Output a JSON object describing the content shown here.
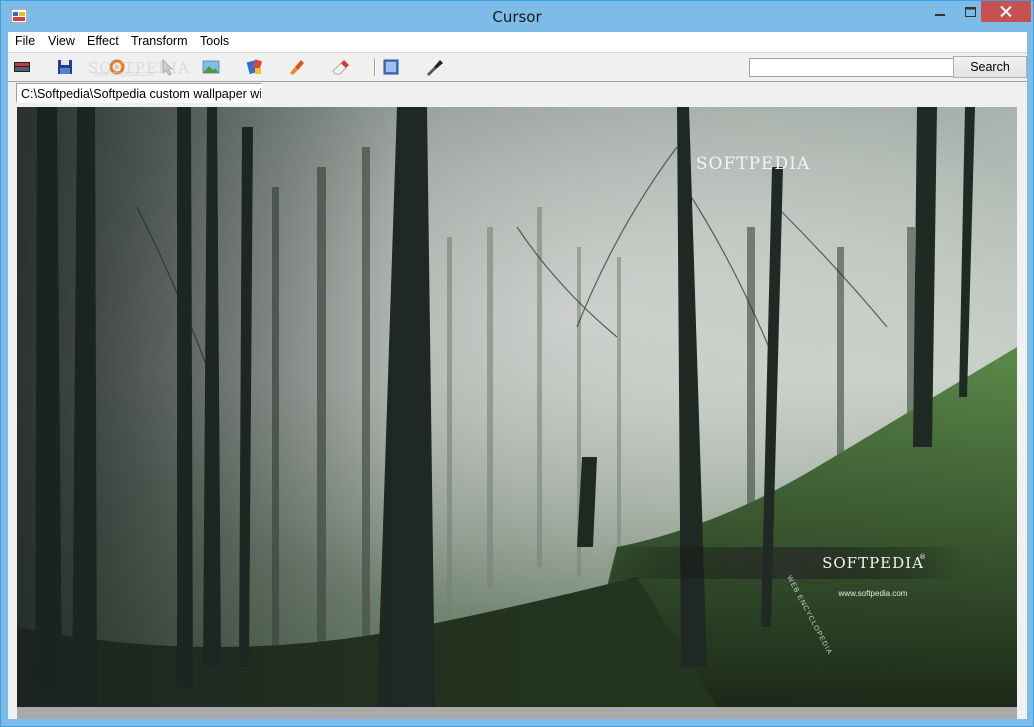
{
  "window": {
    "title": "Cursor"
  },
  "menu": [
    {
      "label": "File"
    },
    {
      "label": "View"
    },
    {
      "label": "Effect"
    },
    {
      "label": "Transform"
    },
    {
      "label": "Tools"
    }
  ],
  "toolbar": {
    "items": [
      {
        "name": "open-image-icon"
      },
      {
        "name": "save-icon"
      },
      {
        "name": "refresh-icon"
      },
      {
        "name": "cursor-icon"
      },
      {
        "name": "image-icon"
      },
      {
        "name": "paint-icon"
      },
      {
        "name": "brush-icon"
      },
      {
        "name": "eraser-icon"
      },
      {
        "name": "frame-icon"
      },
      {
        "name": "dropper-icon"
      }
    ],
    "watermark": "SOFTPEDIA",
    "watermark_small": "www.softpedia.com"
  },
  "search": {
    "value": "",
    "button_label": "Search"
  },
  "path": {
    "value": "C:\\Softpedia\\Softpedia custom wallpaper wide.jpg"
  },
  "image": {
    "logo_top": "SOFTPEDIA",
    "logo_bottom": "SOFTPEDIA",
    "logo_reg": "®",
    "url": "www.softpedia.com",
    "side_text": "WEB ENCYCLOPEDIA"
  },
  "colors": {
    "titlebar": "#7dbbe8",
    "close": "#c75050",
    "chrome": "#f0f0f0"
  }
}
